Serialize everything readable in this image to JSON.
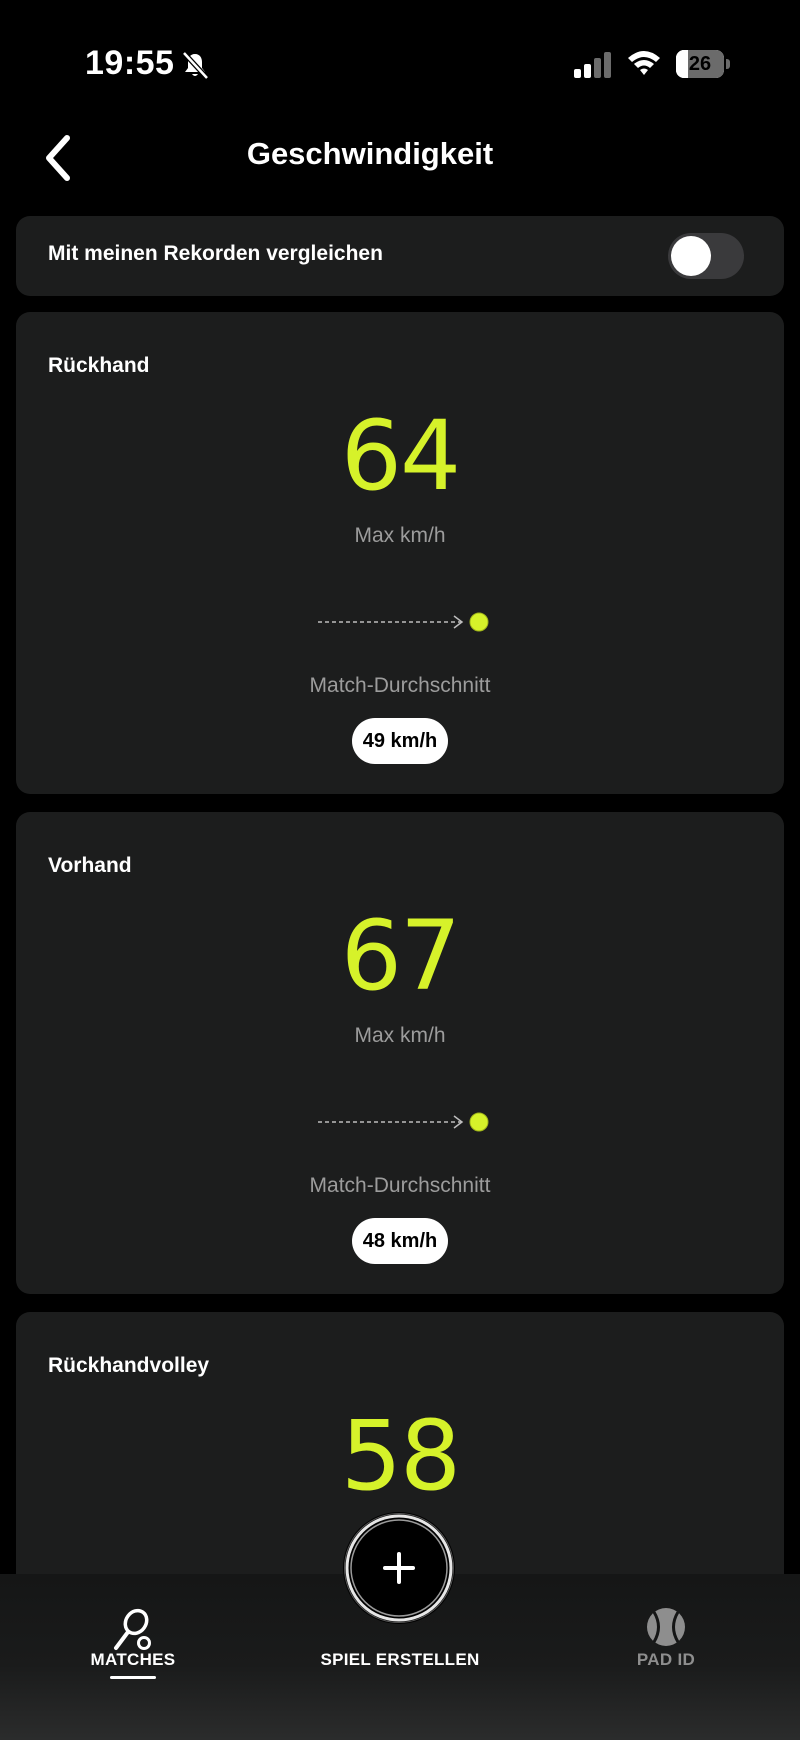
{
  "status_bar": {
    "time": "19:55",
    "battery": {
      "level": 26,
      "label": "26"
    },
    "icons": [
      "bell-slash-icon",
      "signal-icon",
      "wifi-icon",
      "battery-icon"
    ]
  },
  "header": {
    "title": "Geschwindigkeit",
    "back_icon": "chevron-left-icon"
  },
  "compare": {
    "label": "Mit meinen Rekorden vergleichen",
    "enabled": false
  },
  "colors": {
    "accent": "#d6f22a",
    "card_bg": "#1c1d1d",
    "muted_text": "#9c9c9c"
  },
  "cards": [
    {
      "title": "Rückhand",
      "max_value": "64",
      "max_unit": "Max km/h",
      "avg_label": "Match-Durchschnitt",
      "avg_value": "49 km/h"
    },
    {
      "title": "Vorhand",
      "max_value": "67",
      "max_unit": "Max km/h",
      "avg_label": "Match-Durchschnitt",
      "avg_value": "48 km/h"
    },
    {
      "title": "Rückhandvolley",
      "max_value": "58"
    }
  ],
  "tab_bar": {
    "items": [
      {
        "label": "MATCHES",
        "icon": "racket-icon",
        "active": true
      },
      {
        "label": "SPIEL ERSTELLEN",
        "icon": "plus-icon",
        "active": false
      },
      {
        "label": "PAD ID",
        "icon": "ball-icon",
        "active": false
      }
    ]
  }
}
